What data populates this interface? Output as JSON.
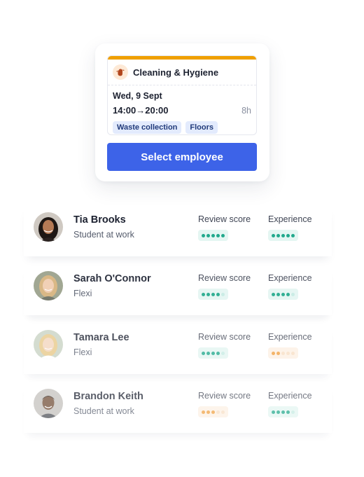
{
  "shift": {
    "category": "Cleaning & Hygiene",
    "category_icon": "cleaning-hand-icon",
    "date": "Wed, 9 Sept",
    "time_start": "14:00",
    "time_arrow": "→",
    "time_end": "20:00",
    "duration": "8h",
    "tags": [
      "Waste collection",
      "Floors"
    ],
    "accent_color": "#f0a000"
  },
  "select_button": {
    "label": "Select employee",
    "color": "#3d63e8"
  },
  "labels": {
    "review": "Review score",
    "experience": "Experience"
  },
  "employees": [
    {
      "name": "Tia Brooks",
      "role": "Student at work",
      "review_score": 5,
      "review_color": "green",
      "experience": 5,
      "experience_color": "green"
    },
    {
      "name": "Sarah O'Connor",
      "role": "Flexi",
      "review_score": 4,
      "review_color": "green",
      "experience": 4,
      "experience_color": "green"
    },
    {
      "name": "Tamara Lee",
      "role": "Flexi",
      "review_score": 4,
      "review_color": "green",
      "experience": 2,
      "experience_color": "orange"
    },
    {
      "name": "Brandon Keith",
      "role": "Student at work",
      "review_score": 3,
      "review_color": "orange",
      "experience": 4,
      "experience_color": "green"
    }
  ],
  "rating_max": 5
}
